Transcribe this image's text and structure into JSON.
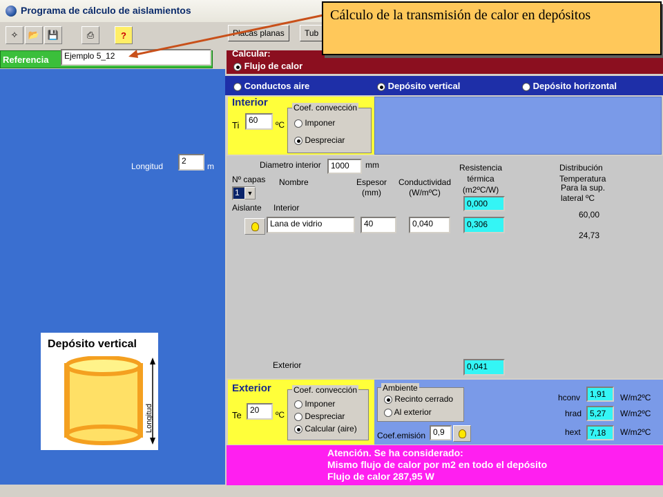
{
  "window": {
    "title": "Programa de cálculo de aislamientos"
  },
  "toolbar": {
    "tabs": [
      "Placas planas",
      "Tub"
    ]
  },
  "referencia": {
    "label": "Referencia",
    "value": "Ejemplo 5_12"
  },
  "longitud": {
    "label": "Longitud",
    "value": "2",
    "unit": "m"
  },
  "calcular": {
    "label": "Calcular:",
    "option": "Flujo de calor"
  },
  "tipo": {
    "options": [
      "Conductos aire",
      "Depósito vertical",
      "Depósito horizontal"
    ],
    "selected": 1
  },
  "interior": {
    "title": "Interior",
    "ti_label": "Ti",
    "ti_value": "60",
    "unit": "ºC",
    "coef_title": "Coef. convección",
    "imponer": "Imponer",
    "despreciar": "Despreciar"
  },
  "capas": {
    "diametro_label": "Diametro interior",
    "diametro_value": "1000",
    "diametro_unit": "mm",
    "ncapas_label": "Nº capas",
    "ncapas_value": "1",
    "col_nombre": "Nombre",
    "col_espesor": "Espesor",
    "col_espesor_u": "(mm)",
    "col_cond": "Conductividad",
    "col_cond_u": "(W/mºC)",
    "col_res1": "Resistencia",
    "col_res2": "térmica",
    "col_res3": "(m2ºC/W)",
    "col_dist1": "Distribución",
    "col_dist2": "Temperatura",
    "col_dist3": "Para la sup.",
    "col_dist4": "lateral ºC",
    "aislante_label": "Aislante",
    "interior_label": "Interior",
    "res_interior": "0,000",
    "material": "Lana de vidrio",
    "espesor": "40",
    "conductividad": "0,040",
    "resistencia": "0,306",
    "temp1": "60,00",
    "temp2": "24,73",
    "exterior_label": "Exterior",
    "res_exterior": "0,041"
  },
  "exterior": {
    "title": "Exterior",
    "te_label": "Te",
    "te_value": "20",
    "unit": "ºC",
    "coef_title": "Coef. convección",
    "imponer": "Imponer",
    "despreciar": "Despreciar",
    "calcular": "Calcular (aire)",
    "ambiente_title": "Ambiente",
    "recinto": "Recinto cerrado",
    "al_exterior": "Al exterior",
    "emision_label": "Coef.emisión",
    "emision_value": "0,9",
    "hconv_label": "hconv",
    "hconv_value": "1,91",
    "hrad_label": "hrad",
    "hrad_value": "5,27",
    "hext_label": "hext",
    "hext_value": "7,18",
    "h_unit": "W/m2ºC"
  },
  "atencion": {
    "line1": "Atención.   Se ha considerado:",
    "line2": "Mismo flujo de calor por m2 en todo el depósito",
    "line3": "Flujo de calor 287,95 W"
  },
  "deposito_img": {
    "title": "Depósito vertical",
    "dim_label": "Longitud"
  },
  "tooltip": {
    "text": "Cálculo de la transmisión de calor en depósitos"
  }
}
